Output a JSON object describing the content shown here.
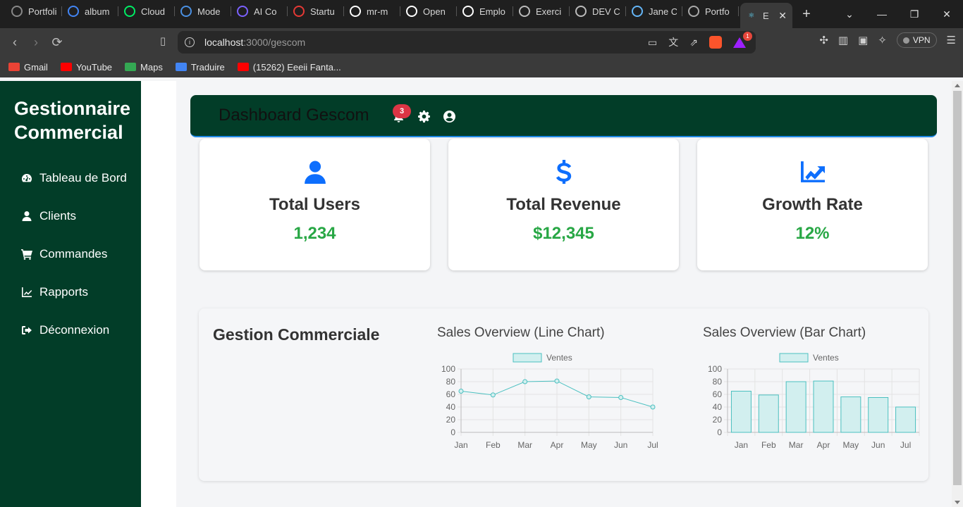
{
  "browser": {
    "tabs": [
      {
        "title": "Portfolio",
        "icon": "globe-icon",
        "color": "#888888"
      },
      {
        "title": "album",
        "icon": "google-icon",
        "color": "#4285f4"
      },
      {
        "title": "Cloud",
        "icon": "mongodb-icon",
        "color": "#00ed64"
      },
      {
        "title": "Mode",
        "icon": "doc-icon",
        "color": "#4a90e2"
      },
      {
        "title": "AI Co",
        "icon": "ai-icon",
        "color": "#7b61ff"
      },
      {
        "title": "Startu",
        "icon": "startup-icon",
        "color": "#e53935"
      },
      {
        "title": "mr-m",
        "icon": "github-icon",
        "color": "#ffffff"
      },
      {
        "title": "Open",
        "icon": "github-icon",
        "color": "#ffffff"
      },
      {
        "title": "Emplo",
        "icon": "info-icon",
        "color": "#ffffff"
      },
      {
        "title": "Exerci",
        "icon": "vue-icon",
        "color": "#bbbbbb"
      },
      {
        "title": "DEV C",
        "icon": "dev-icon",
        "color": "#bbbbbb"
      },
      {
        "title": "Jane C",
        "icon": "laptop-icon",
        "color": "#64b5f6"
      },
      {
        "title": "Portfo",
        "icon": "globe-icon",
        "color": "#aaaaaa"
      }
    ],
    "active_tab": {
      "title": "E",
      "icon": "react-icon",
      "color": "#61dafb"
    },
    "url_host": "localhost",
    "url_path": ":3000/gescom",
    "bat_count": "1",
    "vpn_label": "VPN",
    "bookmarks": [
      {
        "label": "Gmail",
        "color": "#ea4335"
      },
      {
        "label": "YouTube",
        "color": "#ff0000"
      },
      {
        "label": "Maps",
        "color": "#34a853"
      },
      {
        "label": "Traduire",
        "color": "#4285f4"
      },
      {
        "label": "(15262) Eeeii Fanta...",
        "color": "#ff0000"
      }
    ]
  },
  "sidebar": {
    "brand": "Gestionnaire Commercial",
    "items": [
      {
        "label": "Tableau de Bord",
        "icon": "dashboard-icon"
      },
      {
        "label": "Clients",
        "icon": "user-icon"
      },
      {
        "label": "Commandes",
        "icon": "cart-icon"
      },
      {
        "label": "Rapports",
        "icon": "chart-line-icon"
      },
      {
        "label": "Déconnexion",
        "icon": "logout-icon"
      }
    ]
  },
  "header": {
    "title": "Dashboard Gescom",
    "notification_count": "3"
  },
  "stats": [
    {
      "label": "Total Users",
      "value": "1,234",
      "icon": "user-icon"
    },
    {
      "label": "Total Revenue",
      "value": "$12,345",
      "icon": "dollar-icon"
    },
    {
      "label": "Growth Rate",
      "value": "12%",
      "icon": "trend-up-icon"
    }
  ],
  "section": {
    "title": "Gestion Commerciale"
  },
  "colors": {
    "sidebar_bg": "#023d28",
    "accent": "#0d6efd",
    "value_green": "#28a745",
    "chart_line": "#4bc0c0",
    "chart_fill": "#d2efef"
  },
  "chart_data": [
    {
      "type": "line",
      "title": "Sales Overview (Line Chart)",
      "categories": [
        "Jan",
        "Feb",
        "Mar",
        "Apr",
        "May",
        "Jun",
        "Jul"
      ],
      "series": [
        {
          "name": "Ventes",
          "values": [
            65,
            59,
            80,
            81,
            56,
            55,
            40
          ]
        }
      ],
      "ylim": [
        0,
        100
      ],
      "yticks": [
        0,
        20,
        40,
        60,
        80,
        100
      ],
      "legend": "top",
      "grid": true
    },
    {
      "type": "bar",
      "title": "Sales Overview (Bar Chart)",
      "categories": [
        "Jan",
        "Feb",
        "Mar",
        "Apr",
        "May",
        "Jun",
        "Jul"
      ],
      "series": [
        {
          "name": "Ventes",
          "values": [
            65,
            59,
            80,
            81,
            56,
            55,
            40
          ]
        }
      ],
      "ylim": [
        0,
        100
      ],
      "yticks": [
        0,
        20,
        40,
        60,
        80,
        100
      ],
      "legend": "top",
      "grid": true
    }
  ]
}
